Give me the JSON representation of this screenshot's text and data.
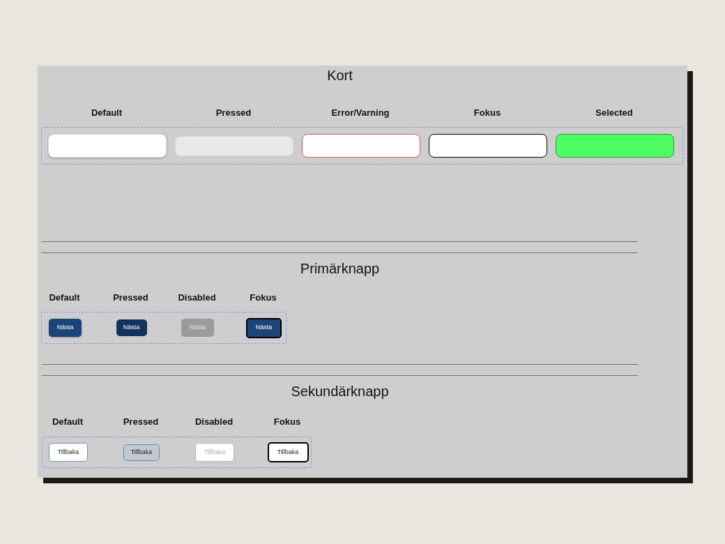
{
  "sections": [
    {
      "kind": "card",
      "title": "Kort",
      "variants": [
        {
          "label": "Default",
          "kind": "default"
        },
        {
          "label": "Pressed",
          "kind": "pressed"
        },
        {
          "label": "Error/Varning",
          "kind": "error"
        },
        {
          "label": "Fokus",
          "kind": "focus"
        },
        {
          "label": "Selected",
          "kind": "selected"
        }
      ]
    },
    {
      "kind": "primary",
      "title": "Primärknapp",
      "variants": [
        {
          "label": "Default",
          "kind": "default",
          "text": "Nästa"
        },
        {
          "label": "Pressed",
          "kind": "pressed",
          "text": "Nästa"
        },
        {
          "label": "Disabled",
          "kind": "disabled",
          "text": "Nästa"
        },
        {
          "label": "Fokus",
          "kind": "focus",
          "text": "Nästa"
        }
      ]
    },
    {
      "kind": "secondary",
      "title": "Sekundärknapp",
      "variants": [
        {
          "label": "Default",
          "kind": "default",
          "text": "Tillbaka"
        },
        {
          "label": "Pressed",
          "kind": "pressed",
          "text": "Tillbaka"
        },
        {
          "label": "Disabled",
          "kind": "disabled",
          "text": "Tillbaka"
        },
        {
          "label": "Fokus",
          "kind": "focus",
          "text": "Tillbaka"
        }
      ]
    }
  ]
}
